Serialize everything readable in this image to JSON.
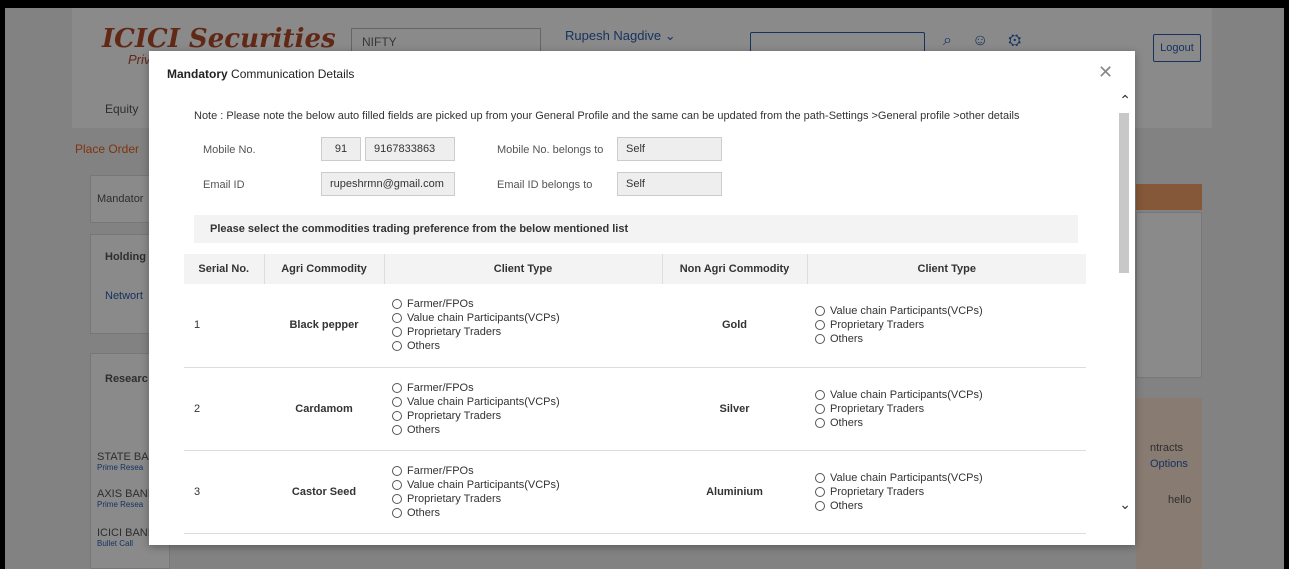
{
  "background": {
    "logo": "ICICI Securities",
    "logo_sub": "Privé",
    "nifty": "NIFTY",
    "user_name": "Rupesh Nagdive",
    "logout": "Logout",
    "equity": "Equity",
    "place_order": "Place Order",
    "side_items": [
      "Mandator",
      "Holding",
      "Networt",
      "Researc"
    ],
    "stocks": [
      {
        "name": "STATE BA",
        "sub": "Prime Resea"
      },
      {
        "name": "AXIS BANI",
        "sub": "Prime Resea"
      },
      {
        "name": "ICICI BANI",
        "sub": "Bullet Call"
      }
    ],
    "right_snippets": [
      "ntracts",
      "Options",
      "hello"
    ]
  },
  "modal": {
    "title_bold": "Mandatory",
    "title_rest": " Communication Details",
    "note": "Note : Please note the below auto filled fields are picked up from your General Profile and the same can be updated from the path-Settings >General profile >other details",
    "mobile_label": "Mobile No.",
    "mobile_code": "91",
    "mobile_number": "9167833863",
    "mobile_belongs_label": "Mobile No. belongs to",
    "mobile_belongs_value": "Self",
    "email_label": "Email ID",
    "email_value": "rupeshrmn@gmail.com",
    "email_belongs_label": "Email ID belongs to",
    "email_belongs_value": "Self",
    "preference_heading": "Please select the commodities trading preference from the below mentioned list",
    "columns": [
      "Serial No.",
      "Agri Commodity",
      "Client Type",
      "Non Agri Commodity",
      "Client Type"
    ],
    "agri_options": [
      "Farmer/FPOs",
      "Value chain Participants(VCPs)",
      "Proprietary Traders",
      "Others"
    ],
    "nonagri_options": [
      "Value chain Participants(VCPs)",
      "Proprietary Traders",
      "Others"
    ],
    "rows": [
      {
        "serial": "1",
        "agri": "Black pepper",
        "nonagri": "Gold"
      },
      {
        "serial": "2",
        "agri": "Cardamom",
        "nonagri": "Silver"
      },
      {
        "serial": "3",
        "agri": "Castor Seed",
        "nonagri": "Aluminium"
      }
    ]
  }
}
